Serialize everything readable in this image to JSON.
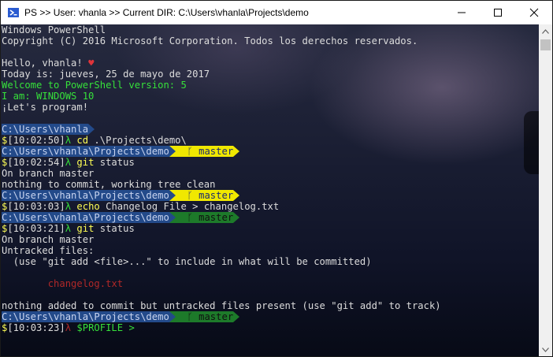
{
  "window": {
    "title": "PS >> User: vhanla >> Current DIR: C:\\Users\\vhanla\\Projects\\demo",
    "icons": {
      "app": "powershell-icon",
      "minimize": "minimize-icon",
      "maximize": "maximize-icon",
      "close": "close-icon"
    }
  },
  "terminal": {
    "header": [
      "Windows PowerShell",
      "Copyright (C) 2016 Microsoft Corporation. Todos los derechos reservados."
    ],
    "greeting": "Hello, vhanla! ",
    "heart": "♥",
    "today": "Today is: jueves, 25 de mayo de 2017",
    "welcome": "Welcome to PowerShell version: 5",
    "iam": "I am: WINDOWS 10",
    "letsgo": "¡Let's program!",
    "prompt1_path": "C:\\Users\\vhanla",
    "cmd1_time": "[10:02:50]",
    "cmd1_cmd": "cd",
    "cmd1_args": " .\\Projects\\demo\\",
    "prompt2_path": "C:\\Users\\vhanla\\Projects\\demo",
    "branch_icon": "ᚴ",
    "branch": " master",
    "cmd2_time": "[10:02:54]",
    "cmd2_cmd": "git",
    "cmd2_args": " status",
    "out2": [
      "On branch master",
      "nothing to commit, working tree clean"
    ],
    "cmd3_time": "[10:03:03]",
    "cmd3_cmd": "echo",
    "cmd3_args": " Changelog File > changelog.txt",
    "cmd4_time": "[10:03:21]",
    "cmd4_cmd": "git",
    "cmd4_args": " status",
    "out4": [
      "On branch master",
      "Untracked files:",
      "  (use \"git add <file>...\" to include in what will be committed)",
      "",
      "        changelog.txt",
      "",
      "nothing added to commit but untracked files present (use \"git add\" to track)"
    ],
    "cmd5_time": "[10:03:23]",
    "cmd5_cmd": "$PROFILE",
    "cmd5_args": " >",
    "dollar": "$",
    "lambda": "λ ",
    "colors": {
      "path_bg": "#234a8a",
      "branch_clean": "#f0e800",
      "branch_dirty": "#1d7a2a",
      "prompt_green": "#36e03a",
      "error_red": "#b02828"
    }
  }
}
